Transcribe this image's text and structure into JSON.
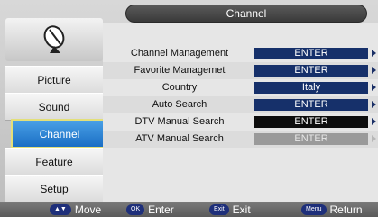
{
  "title": "Channel",
  "sidebar": {
    "items": [
      {
        "label": "Picture"
      },
      {
        "label": "Sound"
      },
      {
        "label": "Channel"
      },
      {
        "label": "Feature"
      },
      {
        "label": "Setup"
      }
    ],
    "active": "Channel"
  },
  "rows": [
    {
      "label": "Channel Management",
      "value": "ENTER"
    },
    {
      "label": "Favorite Managemet",
      "value": "ENTER"
    },
    {
      "label": "Country",
      "value": "Italy"
    },
    {
      "label": "Auto Search",
      "value": "ENTER"
    },
    {
      "label": "DTV Manual Search",
      "value": "ENTER"
    },
    {
      "label": "ATV Manual Search",
      "value": "ENTER"
    }
  ],
  "footer": {
    "move_key": "▲▼",
    "move": "Move",
    "enter_key": "OK",
    "enter": "Enter",
    "exit_key": "Exit",
    "exit": "Exit",
    "return_key": "Menu",
    "return": "Return"
  },
  "colors": {
    "active_item": "#1a6ec4",
    "value_box": "#16306a",
    "selected_value": "#0d0d0d",
    "disabled_value": "#9a9a9a"
  }
}
